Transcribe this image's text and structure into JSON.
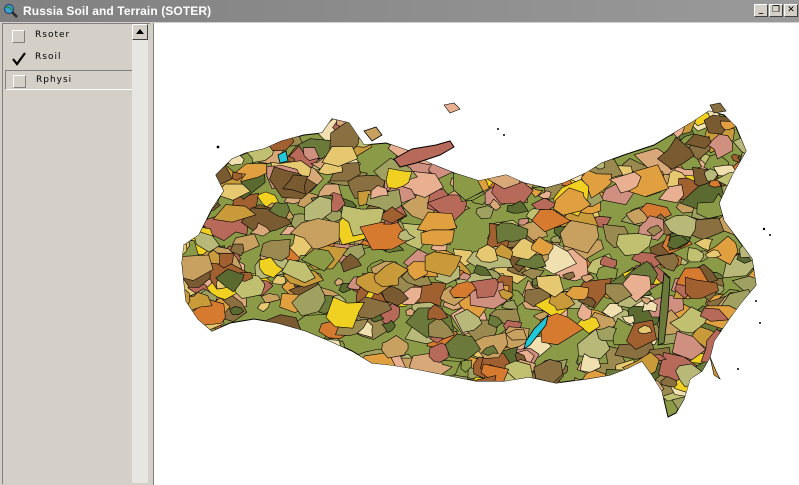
{
  "window": {
    "title": "Russia Soil and Terrain (SOTER)",
    "controls": {
      "minimize": "_",
      "restore": "❐",
      "close": "✕"
    }
  },
  "toc": {
    "layers": [
      {
        "label": "Rsoter",
        "checked": false,
        "selected": false
      },
      {
        "label": "Rsoil",
        "checked": true,
        "selected": false
      },
      {
        "label": "Rphysi",
        "checked": false,
        "selected": true
      }
    ]
  },
  "map": {
    "layer": "Rsoil",
    "palette": [
      "#8b9a46",
      "#6b7a3a",
      "#c8a060",
      "#e8b090",
      "#d67a30",
      "#a06030",
      "#c89a3a",
      "#f0d020",
      "#e6c870",
      "#8a7040",
      "#b86a5a",
      "#5a6a30",
      "#d8a878",
      "#9a8a50",
      "#c0c070",
      "#f0e0b0",
      "#7a5a30",
      "#e0a040",
      "#a0a060",
      "#d09080",
      "#b8b878",
      "#2ad0d8"
    ],
    "outline_color": "#000000",
    "water_color": "#22c8d8"
  }
}
